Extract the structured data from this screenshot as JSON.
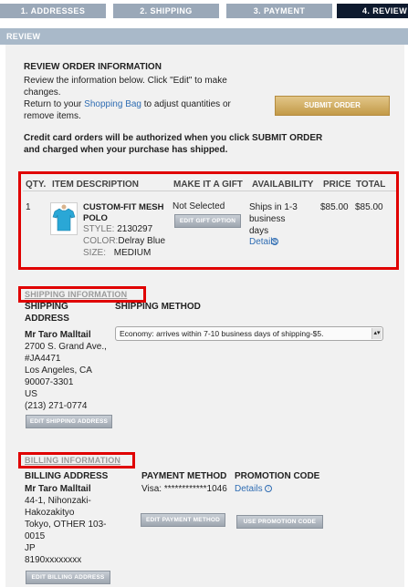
{
  "steps": [
    {
      "label": "1. ADDRESSES"
    },
    {
      "label": "2. SHIPPING"
    },
    {
      "label": "3. PAYMENT"
    },
    {
      "label": "4. REVIEW"
    }
  ],
  "section_title": "REVIEW",
  "review": {
    "heading": "REVIEW ORDER INFORMATION",
    "line1": "Review the information below. Click \"Edit\" to make",
    "line2": "changes.",
    "line3_pre": "Return to your ",
    "line3_link": "Shopping Bag",
    "line3_post": " to adjust quantities or",
    "line4": "remove items.",
    "submit_label": "SUBMIT ORDER",
    "notice1": "Credit card orders will be authorized when you click SUBMIT ORDER",
    "notice2": "and charged when your purchase has shipped."
  },
  "items_table": {
    "headers": {
      "qty": "QTY.",
      "desc": "ITEM DESCRIPTION",
      "gift": "MAKE IT A GIFT",
      "avail": "AVAILABILITY",
      "price": "PRICE",
      "total": "TOTAL"
    },
    "row": {
      "qty": "1",
      "name1": "CUSTOM-FIT MESH",
      "name2": "POLO",
      "style_label": "STYLE:",
      "style_value": "2130297",
      "color_label": "COLOR:",
      "color_value": "Delray Blue",
      "size_label": "SIZE:",
      "size_value": "MEDIUM",
      "gift_status": "Not Selected",
      "gift_button": "EDIT GIFT OPTION",
      "avail1": "Ships in 1-3",
      "avail2": "business",
      "avail3": "days",
      "details_link": "Details",
      "price": "$85.00",
      "total": "$85.00"
    }
  },
  "shipping": {
    "section_heading": "SHIPPING INFORMATION",
    "address_heading1": "SHIPPING",
    "address_heading2": "ADDRESS",
    "method_heading": "SHIPPING METHOD",
    "name": "Mr Taro Malltail",
    "addr1": "2700 S. Grand Ave.,",
    "addr2": "#JA4471",
    "addr3": "Los Angeles, CA",
    "addr4": "90007-3301",
    "addr5": "US",
    "phone": "(213) 271-0774",
    "method_value": "Economy: arrives within 7-10 business days of shipping-$5.",
    "edit_button": "EDIT SHIPPING ADDRESS"
  },
  "billing": {
    "section_heading": "BILLING INFORMATION",
    "address_heading": "BILLING ADDRESS",
    "payment_heading": "PAYMENT METHOD",
    "promo_heading": "PROMOTION CODE",
    "name": "Mr Taro Malltail",
    "addr1": "44-1, Nihonzaki-",
    "addr2": "Hakozakityo",
    "addr3": "Tokyo, OTHER 103-",
    "addr4": "0015",
    "addr5": "JP",
    "phone": "8190xxxxxxxx",
    "payment_value": "Visa: ************1046",
    "promo_details": "Details",
    "edit_payment_button": "EDIT PAYMENT METHOD",
    "promo_button": "USE PROMOTION CODE",
    "edit_billing_button": "EDIT BILLING ADDRESS"
  },
  "colors": {
    "accent_red": "#e00000",
    "link": "#2f6db3",
    "submit_gold": "#c39a48",
    "active_step": "#0e1a2e"
  },
  "icons": {
    "polo": "polo-shirt-thumbnail-icon",
    "info": "info-icon",
    "dropdown": "chevron-down-icon"
  }
}
